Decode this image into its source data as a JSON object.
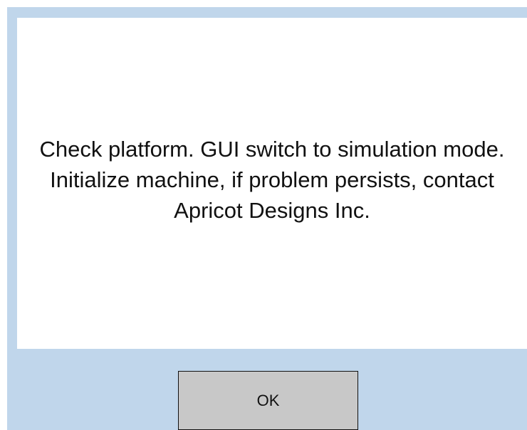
{
  "dialog": {
    "message": "Check platform. GUI switch to simulation mode. Initialize machine, if problem persists, contact Apricot Designs Inc.",
    "ok_label": "OK"
  },
  "colors": {
    "frame_background": "#c0d6eb",
    "panel_background": "#ffffff",
    "button_background": "#c8c8c8",
    "button_border": "#101010",
    "text": "#111111"
  }
}
